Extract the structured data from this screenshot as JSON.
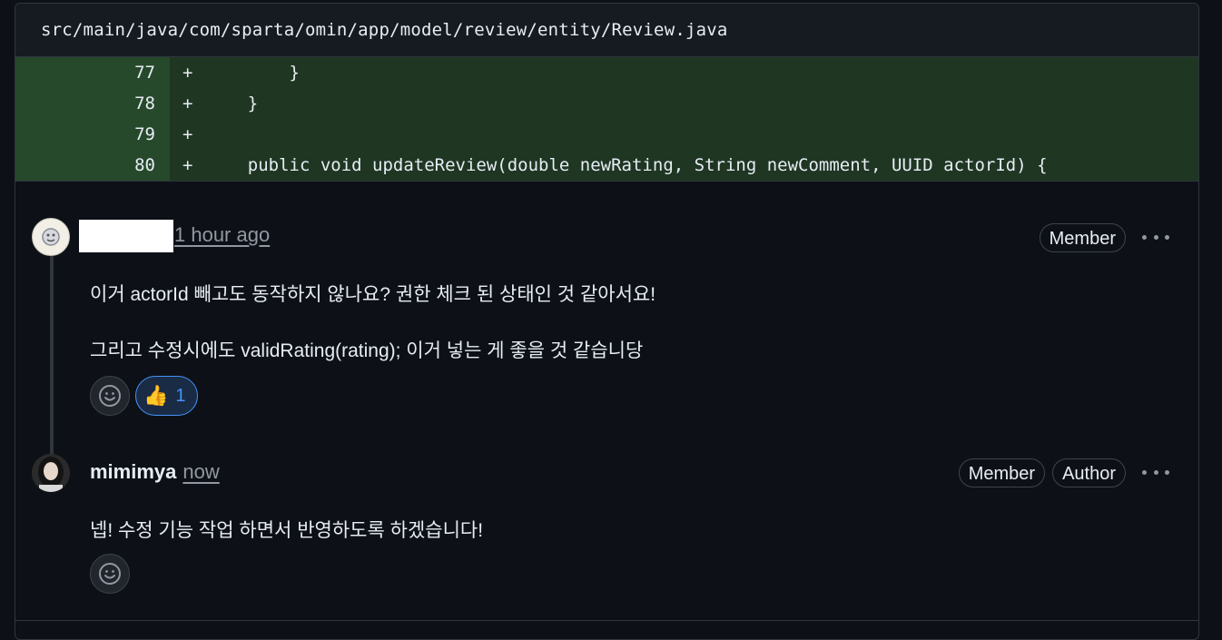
{
  "file": {
    "path": "src/main/java/com/sparta/omin/app/model/review/entity/Review.java"
  },
  "diff": [
    {
      "num": "77",
      "sign": "+",
      "code": "        }"
    },
    {
      "num": "78",
      "sign": "+",
      "code": "    }"
    },
    {
      "num": "79",
      "sign": "+",
      "code": ""
    },
    {
      "num": "80",
      "sign": "+",
      "code": "    public void updateReview(double newRating, String newComment, UUID actorId) {"
    }
  ],
  "comments": [
    {
      "author": "",
      "time": "1 hour ago",
      "badges": [
        "Member"
      ],
      "lines": [
        "이거 actorId 빼고도 동작하지 않나요? 권한 체크 된 상태인 것 같아서요!",
        "그리고 수정시에도 validRating(rating); 이거 넣는 게 좋을 것 같습니당"
      ],
      "reaction": {
        "emoji": "👍",
        "count": "1"
      }
    },
    {
      "author": "mimimya",
      "time": "now",
      "badges": [
        "Member",
        "Author"
      ],
      "lines": [
        "넵! 수정 기능 작업 하면서 반영하도록 하겠습니다!"
      ]
    }
  ],
  "icons": {
    "add_reaction": "smiley-icon",
    "menu": "kebab-icon"
  },
  "colors": {
    "accent": "#4493f8",
    "diff_added": "#1f3623"
  }
}
